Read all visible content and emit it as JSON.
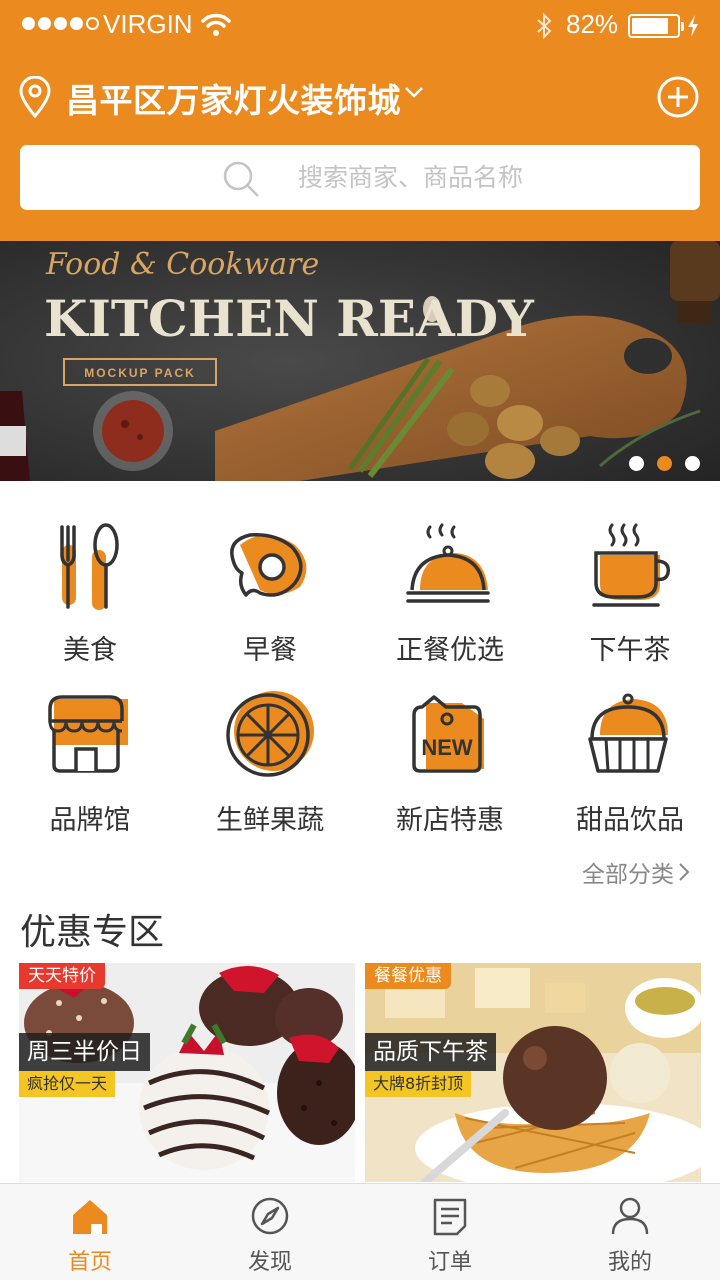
{
  "status_bar": {
    "carrier": "VIRGIN",
    "battery": "82%",
    "battery_level": 0.82
  },
  "header": {
    "location": "昌平区万家灯火装饰城",
    "search_placeholder": "搜索商家、商品名称"
  },
  "banner": {
    "title_script": "Food & Cookware",
    "title_main": "KITCHEN READY",
    "badge": "MOCKUP PACK",
    "slide_count": 3,
    "active_slide": 2
  },
  "categories": [
    {
      "label": "美食",
      "icon": "fork-spoon-icon"
    },
    {
      "label": "早餐",
      "icon": "fried-egg-icon"
    },
    {
      "label": "正餐优选",
      "icon": "cloche-icon"
    },
    {
      "label": "下午茶",
      "icon": "coffee-cup-icon"
    },
    {
      "label": "品牌馆",
      "icon": "storefront-icon"
    },
    {
      "label": "生鲜果蔬",
      "icon": "orange-slice-icon"
    },
    {
      "label": "新店特惠",
      "icon": "new-tag-icon"
    },
    {
      "label": "甜品饮品",
      "icon": "cupcake-icon"
    }
  ],
  "all_categories": "全部分类",
  "promo": {
    "title": "优惠专区",
    "cards": [
      {
        "tag": "天天特价",
        "title": "周三半价日",
        "subtitle": "疯抢仅一天"
      },
      {
        "tag": "餐餐优惠",
        "title": "品质下午茶",
        "subtitle": "大牌8折封顶"
      }
    ]
  },
  "tabbar": [
    {
      "label": "首页",
      "icon": "home-icon",
      "active": true
    },
    {
      "label": "发现",
      "icon": "compass-icon",
      "active": false
    },
    {
      "label": "订单",
      "icon": "order-list-icon",
      "active": false
    },
    {
      "label": "我的",
      "icon": "user-icon",
      "active": false
    }
  ],
  "colors": {
    "accent": "#EB8A1E",
    "dark": "#333333",
    "red_tag": "#E8392E",
    "yellow_tag": "#F3C624"
  }
}
